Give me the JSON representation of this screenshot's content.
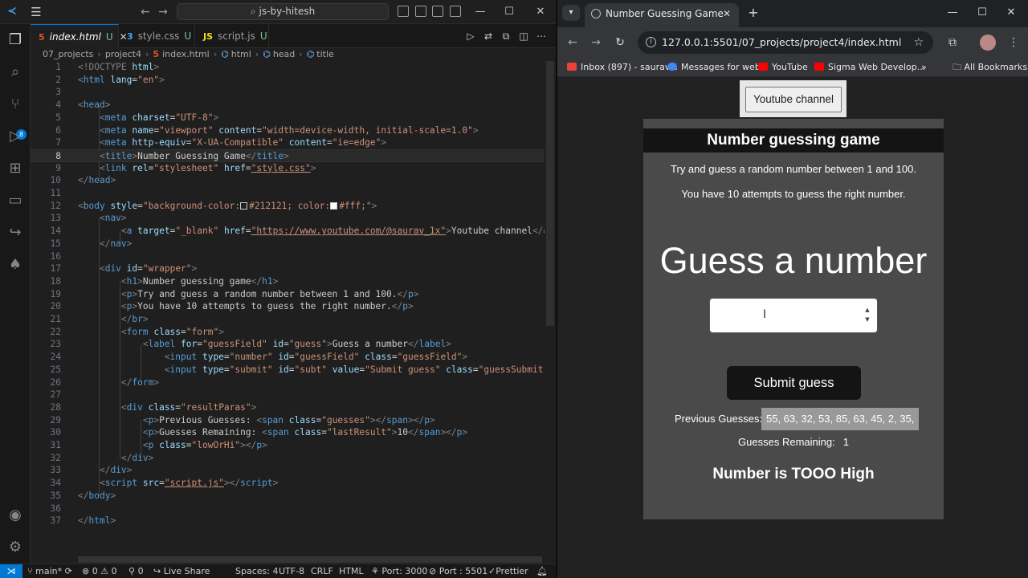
{
  "vscode": {
    "search": "js-by-hitesh",
    "tabs": [
      {
        "icon": "5",
        "name": "index.html",
        "status": "U"
      },
      {
        "icon": "3",
        "name": "style.css",
        "status": "U"
      },
      {
        "icon": "JS",
        "name": "script.js",
        "status": "U"
      }
    ],
    "breadcrumb": [
      "07_projects",
      "project4",
      "index.html",
      "html",
      "head",
      "title"
    ],
    "status": {
      "branch": "main*",
      "errors": "0",
      "warnings": "0",
      "ports": "0",
      "live_share": "Live Share",
      "spaces": "Spaces: 4",
      "encoding": "UTF-8",
      "eol": "CRLF",
      "language": "HTML",
      "port": "Port: 3000",
      "port2": "Port : 5501",
      "prettier": "Prettier"
    },
    "line_numbers": [
      "1",
      "2",
      "3",
      "4",
      "5",
      "6",
      "7",
      "8",
      "9",
      "10",
      "11",
      "12",
      "13",
      "14",
      "15",
      "16",
      "17",
      "18",
      "19",
      "20",
      "21",
      "22",
      "23",
      "24",
      "25",
      "26",
      "27",
      "28",
      "29",
      "30",
      "31",
      "32",
      "33",
      "34",
      "35",
      "36",
      "37"
    ],
    "code": {
      "l1_tag": "<!DOCTYPE",
      "l1_name": "html",
      "l1_end": ">",
      "l2_open": "<",
      "l2_tag": "html",
      "l2_attr": "lang",
      "l2_val": "\"en\"",
      "l4_tag": "head",
      "l5_tag": "meta",
      "l5_a1": "charset",
      "l5_v1": "\"UTF-8\"",
      "l6_tag": "meta",
      "l6_a1": "name",
      "l6_v1": "\"viewport\"",
      "l6_a2": "content",
      "l6_v2": "\"width=device-width, initial-scale=1.0\"",
      "l7_tag": "meta",
      "l7_a1": "http-equiv",
      "l7_v1": "\"X-UA-Compatible\"",
      "l7_a2": "content",
      "l7_v2": "\"ie=edge\"",
      "l8_tag": "title",
      "l8_text": "Number Guessing Game",
      "l9_tag": "link",
      "l9_a1": "rel",
      "l9_v1": "\"stylesheet\"",
      "l9_a2": "href",
      "l9_v2": "\"style.css\"",
      "l10_tag": "head",
      "l12_tag": "body",
      "l12_a1": "style",
      "l12_v1a": "\"background-color:",
      "l12_v1b": "#212121; color:",
      "l12_v1c": "#fff;\"",
      "l13_tag": "nav",
      "l14_tag": "a",
      "l14_a1": "target",
      "l14_v1": "\"_blank\"",
      "l14_a2": "href",
      "l14_v2": "\"https://www.youtube.com/@saurav_1x\"",
      "l14_text": "Youtube channel",
      "l15_tag": "nav",
      "l17_tag": "div",
      "l17_a1": "id",
      "l17_v1": "\"wrapper\"",
      "l18_tag": "h1",
      "l18_text": "Number guessing game",
      "l19_tag": "p",
      "l19_text": "Try and guess a random number between 1 and 100.",
      "l20_tag": "p",
      "l20_text": "You have 10 attempts to guess the right number.",
      "l21_tag": "br",
      "l22_tag": "form",
      "l22_a1": "class",
      "l22_v1": "\"form\"",
      "l23_tag": "label",
      "l23_a1": "for",
      "l23_v1": "\"guessField\"",
      "l23_a2": "id",
      "l23_v2": "\"guess\"",
      "l23_text": "Guess a number",
      "l24_tag": "input",
      "l24_a1": "type",
      "l24_v1": "\"number\"",
      "l24_a2": "id",
      "l24_v2": "\"guessField\"",
      "l24_a3": "class",
      "l24_v3": "\"guessField\"",
      "l25_tag": "input",
      "l25_a1": "type",
      "l25_v1": "\"submit\"",
      "l25_a2": "id",
      "l25_v2": "\"subt\"",
      "l25_a3": "value",
      "l25_v3": "\"Submit guess\"",
      "l25_a4": "class",
      "l25_v4": "\"guessSubmit\"",
      "l26_tag": "form",
      "l28_tag": "div",
      "l28_a1": "class",
      "l28_v1": "\"resultParas\"",
      "l29_tag": "p",
      "l29_text": "Previous Guesses: ",
      "l29_tag2": "span",
      "l29_a1": "class",
      "l29_v1": "\"guesses\"",
      "l30_tag": "p",
      "l30_text": "Guesses Remaining: ",
      "l30_tag2": "span",
      "l30_a1": "class",
      "l30_v1": "\"lastResult\"",
      "l30_num": "10",
      "l31_tag": "p",
      "l31_a1": "class",
      "l31_v1": "\"lowOrHi\"",
      "l32_tag": "div",
      "l33_tag": "div",
      "l34_tag": "script",
      "l34_a1": "src",
      "l34_v1": "\"script.js\"",
      "l35_tag": "body",
      "l37_tag": "html"
    }
  },
  "browser": {
    "tab_title": "Number Guessing Game",
    "url": "127.0.0.1:5501/07_projects/project4/index.html",
    "bookmarks": [
      {
        "label": "Inbox (897) - saurav...",
        "color": "#ea4335"
      },
      {
        "label": "Messages for web",
        "color": "#4285f4"
      },
      {
        "label": "YouTube",
        "color": "#ff0000"
      },
      {
        "label": "Sigma Web Develop...",
        "color": "#ff0000"
      }
    ],
    "more_bookmarks": "»",
    "all_bookmarks": "All Bookmarks"
  },
  "page": {
    "nav_link": "Youtube channel",
    "title": "Number guessing game",
    "p1": "Try and guess a random number between 1 and 100.",
    "p2": "You have 10 attempts to guess the right number.",
    "label": "Guess a number",
    "input_value": "",
    "submit": "Submit guess",
    "prev_label": "Previous Guesses:",
    "prev_value": "55, 63, 32, 53, 85, 63, 45, 2, 35,",
    "remaining_label": "Guesses Remaining:",
    "remaining_value": "1",
    "result": "Number is TOOO High"
  }
}
